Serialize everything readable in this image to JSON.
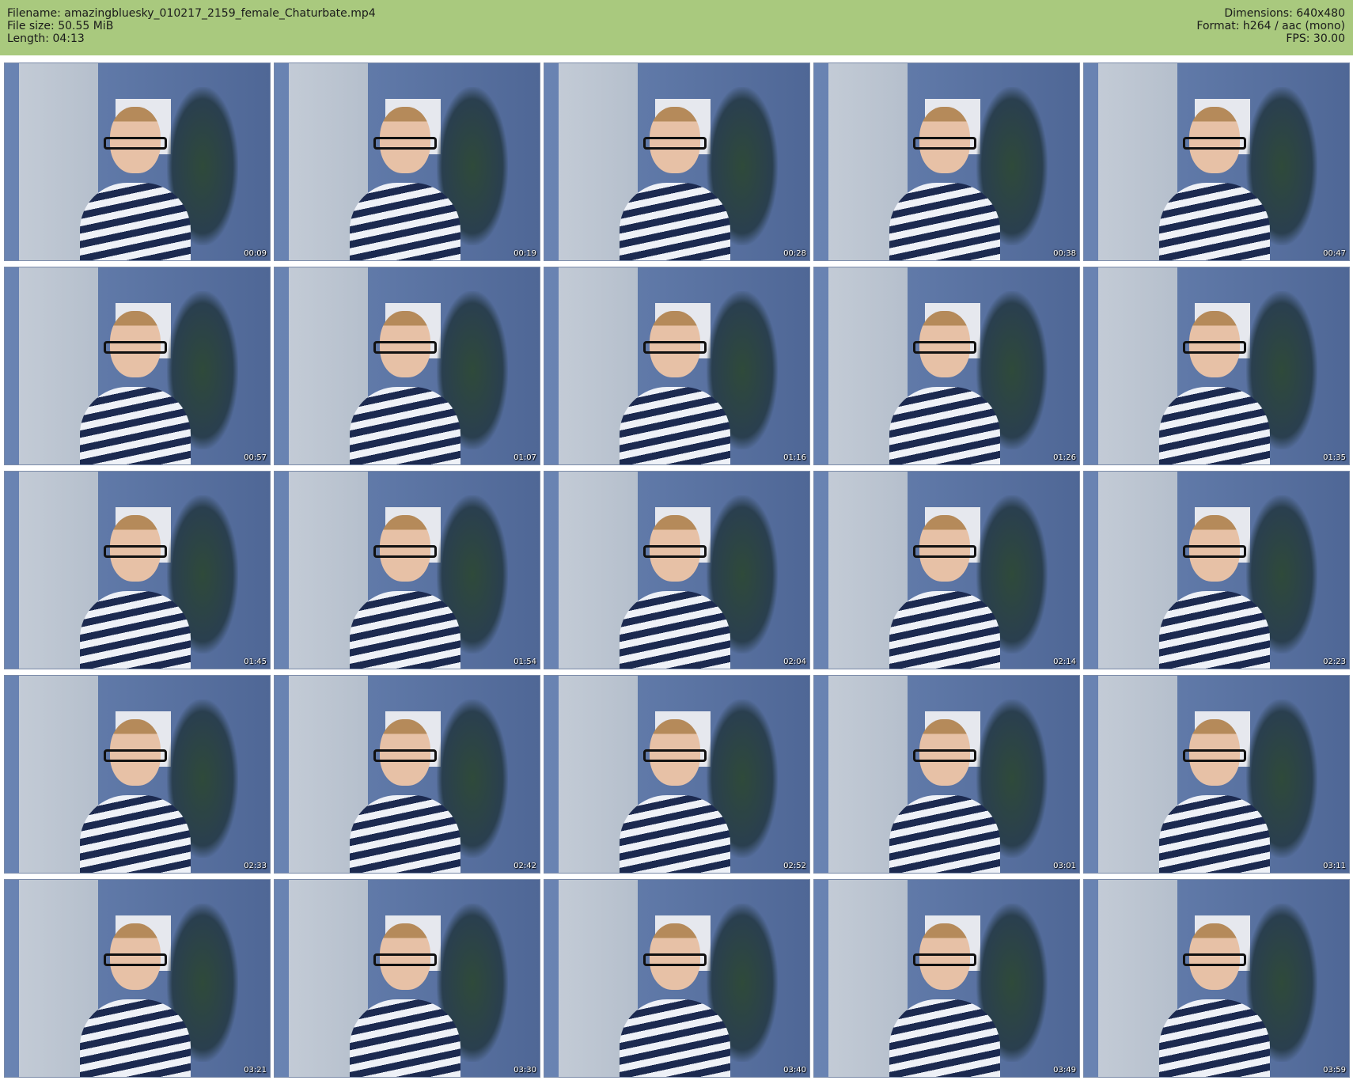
{
  "header": {
    "filename": "Filename: amazingbluesky_010217_2159_female_Chaturbate.mp4",
    "filesize": "File size: 50.55 MiB",
    "length": "Length: 04:13",
    "dimensions": "Dimensions: 640x480",
    "format": "Format: h264 / aac (mono)",
    "fps": "FPS: 30.00"
  },
  "colors": {
    "header_bg": "#a9c97e",
    "wall": "#5b76a6"
  },
  "thumbnails": [
    {
      "timestamp": "00:09"
    },
    {
      "timestamp": "00:19"
    },
    {
      "timestamp": "00:28"
    },
    {
      "timestamp": "00:38"
    },
    {
      "timestamp": "00:47"
    },
    {
      "timestamp": "00:57"
    },
    {
      "timestamp": "01:07"
    },
    {
      "timestamp": "01:16"
    },
    {
      "timestamp": "01:26"
    },
    {
      "timestamp": "01:35"
    },
    {
      "timestamp": "01:45"
    },
    {
      "timestamp": "01:54"
    },
    {
      "timestamp": "02:04"
    },
    {
      "timestamp": "02:14"
    },
    {
      "timestamp": "02:23"
    },
    {
      "timestamp": "02:33"
    },
    {
      "timestamp": "02:42"
    },
    {
      "timestamp": "02:52"
    },
    {
      "timestamp": "03:01"
    },
    {
      "timestamp": "03:11"
    },
    {
      "timestamp": "03:21"
    },
    {
      "timestamp": "03:30"
    },
    {
      "timestamp": "03:40"
    },
    {
      "timestamp": "03:49"
    },
    {
      "timestamp": "03:59"
    }
  ]
}
